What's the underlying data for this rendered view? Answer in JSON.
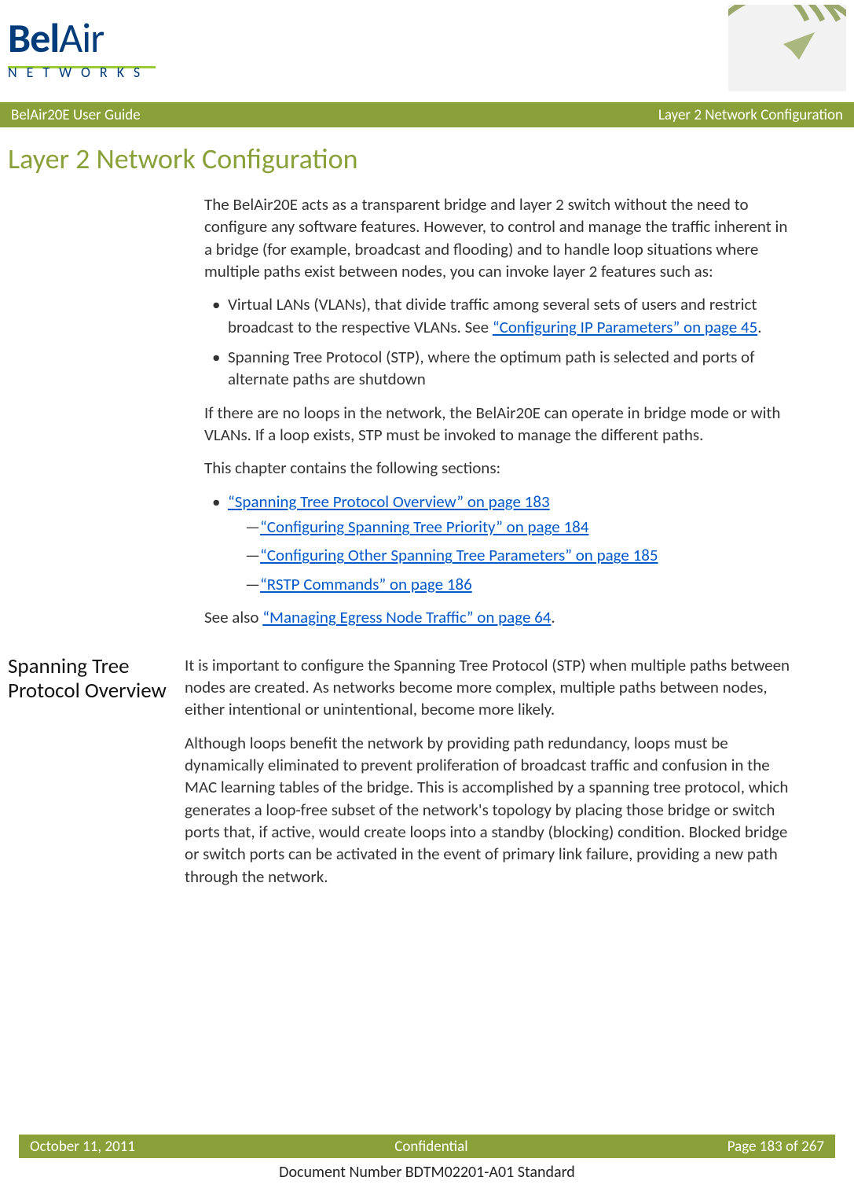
{
  "header": {
    "left": "BelAir20E User Guide",
    "right": "Layer 2 Network Configuration"
  },
  "logo": {
    "brand_part1": "Bel",
    "brand_part2": "Air",
    "subtitle": "NETWORKS"
  },
  "title": "Layer 2 Network Configuration",
  "intro": {
    "p1": "The BelAir20E acts as a transparent bridge and layer 2 switch without the need to configure any software features. However, to control and manage the traffic inherent in a bridge (for example, broadcast and flooding) and to handle loop situations where multiple paths exist between nodes, you can invoke layer 2 features such as:",
    "bullet1_pre": "Virtual LANs (VLANs), that divide traffic among several sets of users and restrict broadcast to the respective VLANs. See ",
    "bullet1_link": "“Configuring IP Parameters” on page 45",
    "bullet1_post": ".",
    "bullet2": "Spanning Tree Protocol (STP), where the optimum path is selected and ports of alternate paths are shutdown",
    "p2": "If there are no loops in the network, the BelAir20E can operate in bridge mode or with VLANs. If a loop exists, STP must be invoked to manage the different paths.",
    "p3": "This chapter contains the following sections:",
    "toc_bullet_link": "“Spanning Tree Protocol Overview” on page 183",
    "toc_sub1": "“Configuring Spanning Tree Priority” on page 184",
    "toc_sub2": "“Configuring Other Spanning Tree Parameters” on page 185",
    "toc_sub3": "“RSTP Commands” on page 186",
    "seealso_pre": "See also ",
    "seealso_link": "“Managing Egress Node Traffic” on page 64",
    "seealso_post": "."
  },
  "section1": {
    "title": "Spanning Tree Protocol Overview",
    "p1": "It is important to configure the Spanning Tree Protocol (STP) when multiple paths between nodes are created. As networks become more complex, multiple paths between nodes, either intentional or unintentional, become more likely.",
    "p2": "Although loops benefit the network by providing path redundancy, loops must be dynamically eliminated to prevent proliferation of broadcast traffic and confusion in the MAC learning tables of the bridge. This is accomplished by a spanning tree protocol, which generates a loop-free subset of the network's topology by placing those bridge or switch ports that, if active, would create loops into a standby (blocking) condition. Blocked bridge or switch ports can be activated in the event of primary link failure, providing a new path through the network."
  },
  "footer": {
    "date": "October 11, 2011",
    "confidential": "Confidential",
    "page": "Page 183 of 267",
    "document": "Document Number BDTM02201-A01 Standard"
  }
}
